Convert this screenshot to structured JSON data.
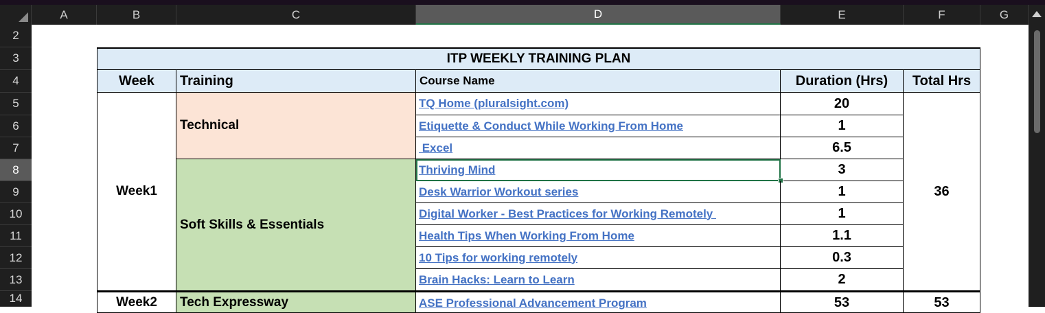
{
  "columns": [
    "A",
    "B",
    "C",
    "D",
    "E",
    "F",
    "G"
  ],
  "rows": [
    "2",
    "3",
    "4",
    "5",
    "6",
    "7",
    "8",
    "9",
    "10",
    "11",
    "12",
    "13",
    "14"
  ],
  "sheet": {
    "title": "ITP WEEKLY TRAINING PLAN",
    "headers": {
      "week": "Week",
      "training": "Training",
      "course": "Course Name",
      "duration": "Duration (Hrs)",
      "total": "Total Hrs"
    },
    "week1": {
      "label": "Week1",
      "total": "36",
      "technical": "Technical",
      "soft": "Soft Skills & Essentials",
      "courses": [
        {
          "name": "TQ Home (pluralsight.com)",
          "hrs": "20"
        },
        {
          "name": "Etiquette & Conduct While Working From Home",
          "hrs": "1"
        },
        {
          "name": " Excel",
          "hrs": "6.5"
        },
        {
          "name": "Thriving Mind",
          "hrs": "3"
        },
        {
          "name": "Desk Warrior Workout series",
          "hrs": "1"
        },
        {
          "name": "Digital Worker - Best Practices for Working Remotely ",
          "hrs": "1"
        },
        {
          "name": "Health Tips When Working From Home",
          "hrs": "1.1"
        },
        {
          "name": "10 Tips for working remotely",
          "hrs": "0.3"
        },
        {
          "name": "Brain Hacks: Learn to Learn",
          "hrs": "2"
        }
      ]
    },
    "week2": {
      "label": "Week2",
      "training": "Tech Expressway",
      "course": "ASE Professional Advancement Program",
      "hrs": "53",
      "total": "53"
    }
  },
  "colors": {
    "header": "#ddebf7",
    "technical": "#fce4d6",
    "soft": "#c6e0b4",
    "link": "#4472c4",
    "selection": "#217346"
  }
}
